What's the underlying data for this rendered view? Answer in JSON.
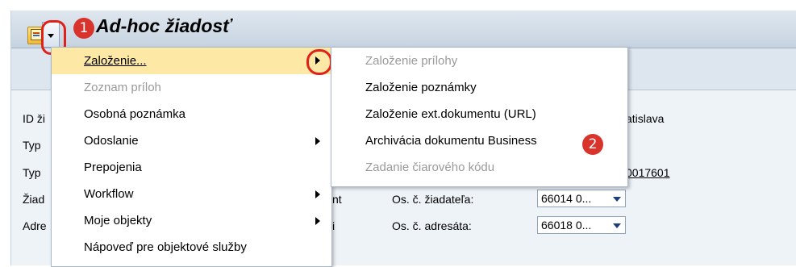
{
  "title": "Ad-hoc žiadosť",
  "badges": {
    "one": "1",
    "two": "2"
  },
  "form": {
    "rows": [
      "ID ži",
      "Typ",
      "Typ",
      "Žiad",
      "Adre"
    ],
    "frag_city": "atislava",
    "frag_num": "0017601",
    "frag_nt": "nt",
    "frag_i": "i",
    "requester_label": "Os. č. žiadateľa:",
    "requester_value": "66014 0...",
    "addressee_label": "Os. č. adresáta:",
    "addressee_value": "66018 0..."
  },
  "menu": {
    "items": [
      {
        "label": "Založenie...",
        "highlighted": true,
        "submenu": true,
        "disabled": false
      },
      {
        "label": "Zoznam príloh",
        "disabled": true
      },
      {
        "label": "Osobná poznámka",
        "disabled": false
      },
      {
        "label": "Odoslanie",
        "submenu": true,
        "disabled": false
      },
      {
        "label": "Prepojenia",
        "disabled": false
      },
      {
        "label": "Workflow",
        "submenu": true,
        "disabled": false
      },
      {
        "label": "Moje objekty",
        "submenu": true,
        "disabled": false
      },
      {
        "label": "Nápoveď pre objektové služby",
        "disabled": false
      }
    ]
  },
  "submenu": {
    "items": [
      {
        "label": "Založenie prílohy",
        "disabled": true
      },
      {
        "label": "Založenie poznámky",
        "disabled": false
      },
      {
        "label": "Založenie ext.dokumentu (URL)",
        "disabled": false
      },
      {
        "label": "Archivácia dokumentu Business",
        "disabled": false
      },
      {
        "label": "Zadanie čiarového kódu",
        "disabled": true
      }
    ]
  },
  "colors": {
    "highlight": "#fde8a6",
    "annotation_red": "#d8342b",
    "title_bar": "#c6d3e0"
  }
}
